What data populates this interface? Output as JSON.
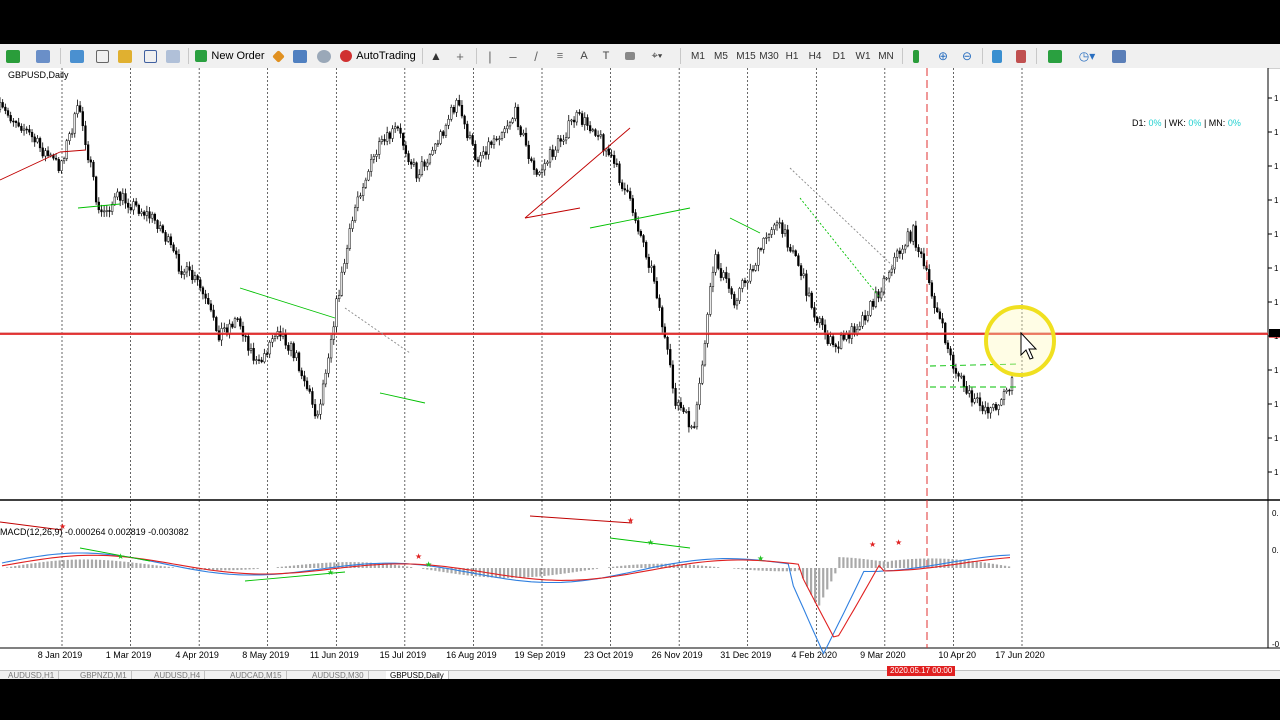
{
  "window": {
    "symbol_label": "GBPUSD,Daily"
  },
  "toolbar": {
    "new_order_label": "New Order",
    "autotrading_label": "AutoTrading",
    "timeframes": [
      "M1",
      "M5",
      "M15",
      "M30",
      "H1",
      "H4",
      "D1",
      "W1",
      "MN"
    ]
  },
  "dwm": {
    "d1_label": "D1:",
    "d1_value": "0%",
    "wk_label": "| WK:",
    "wk_value": "0%",
    "mn_label": "| MN:",
    "mn_value": "0%"
  },
  "macd": {
    "label": "MACD(12,26,9) -0.000264 0.002819 -0.003082"
  },
  "x_axis_labels": [
    "8 Jan 2019",
    "1 Mar 2019",
    "4 Apr 2019",
    "8 May 2019",
    "11 Jun 2019",
    "15 Jul 2019",
    "16 Aug 2019",
    "19 Sep 2019",
    "23 Oct 2019",
    "26 Nov 2019",
    "31 Dec 2019",
    "4 Feb 2020",
    "9 Mar 2020",
    "10 Apr",
    "17 Jun 2020"
  ],
  "price_axis_labels": [
    "1",
    "1",
    "1",
    "1",
    "1",
    "1",
    "1",
    "1",
    "1",
    "1",
    "1",
    "1"
  ],
  "macd_axis_labels": [
    "0.",
    "0.",
    "-0"
  ],
  "crosshair_date": "2020.05.17 00:00",
  "crosshair_date_suffix": "20",
  "tabs": [
    "AUDUSD,H1",
    "GBPNZD,M1",
    "AUDUSD,H4",
    "AUDCAD,M15",
    "AUDUSD,M30",
    "GBPUSD,Daily"
  ],
  "colors": {
    "support_line": "#e00000",
    "bull_line": "#00c000",
    "bear_line": "#c00000",
    "macd_signal": "#e02020",
    "macd_main": "#3080e0",
    "cursor_highlight": "#f0e020"
  },
  "chart_data": {
    "type": "candlestick",
    "symbol": "GBPUSD",
    "timeframe": "Daily",
    "x_range": [
      "2019-01-08",
      "2020-06-17"
    ],
    "candles": [
      [
        1,
        9.7
      ],
      [
        1,
        9.35
      ],
      [
        1,
        8.7
      ],
      [
        1,
        8.2
      ],
      [
        1,
        9.8
      ],
      [
        1,
        6.9
      ],
      [
        1,
        7.4
      ],
      [
        1,
        7.1
      ],
      [
        1,
        6.7
      ],
      [
        1,
        5.6
      ],
      [
        1,
        5.1
      ],
      [
        1,
        3.8
      ],
      [
        1,
        4.2
      ],
      [
        1,
        2.9
      ],
      [
        1,
        4.0
      ],
      [
        1,
        3.1
      ],
      [
        1,
        1.6
      ],
      [
        1,
        4.7
      ],
      [
        1,
        7.4
      ],
      [
        1,
        8.6
      ],
      [
        1,
        9.2
      ],
      [
        1,
        8.0
      ],
      [
        1,
        8.8
      ],
      [
        1,
        9.9
      ],
      [
        1,
        8.4
      ],
      [
        1,
        9.0
      ],
      [
        1,
        9.6
      ],
      [
        1,
        7.9
      ],
      [
        1,
        8.7
      ],
      [
        1,
        9.5
      ],
      [
        1,
        9.2
      ],
      [
        1,
        8.2
      ],
      [
        1,
        6.9
      ],
      [
        1,
        5.2
      ],
      [
        1,
        2.1
      ],
      [
        1,
        1.2
      ],
      [
        1,
        5.8
      ],
      [
        1,
        4.7
      ],
      [
        1,
        5.6
      ],
      [
        1,
        6.8
      ],
      [
        1,
        6.0
      ],
      [
        1,
        4.4
      ],
      [
        1,
        3.4
      ],
      [
        1,
        3.9
      ],
      [
        1,
        4.6
      ],
      [
        1,
        5.7
      ],
      [
        1,
        6.5
      ],
      [
        1,
        4.8
      ],
      [
        1,
        3.0
      ],
      [
        1,
        2.0
      ],
      [
        1,
        1.8
      ],
      [
        1,
        2.5
      ]
    ],
    "support_level": 3.8,
    "macd_series": [
      {
        "name": "MACD(12,26,9)",
        "values": [
          -0.000264,
          0.002819,
          -0.003082
        ]
      }
    ]
  }
}
